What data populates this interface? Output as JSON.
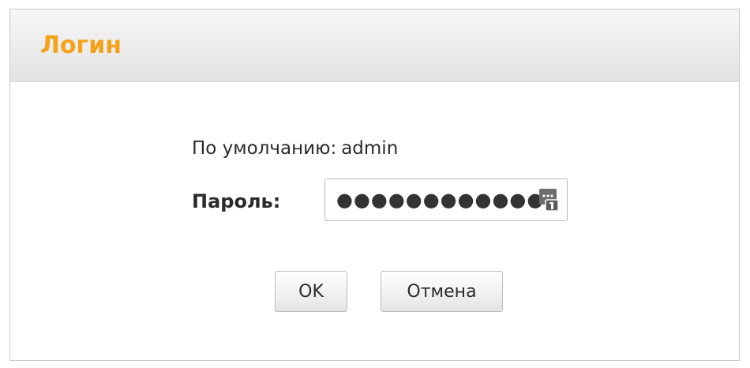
{
  "dialog": {
    "title": "Логин",
    "default_label": "По умолчанию:",
    "default_value": "admin",
    "password_label": "Пароль:",
    "password_value": "●●●●●●●●●●●●",
    "password_icon": "keyring-icon",
    "ok_label": "OK",
    "cancel_label": "Отмена"
  },
  "colors": {
    "title": "#f3a21a",
    "border": "#c9c9c9"
  }
}
